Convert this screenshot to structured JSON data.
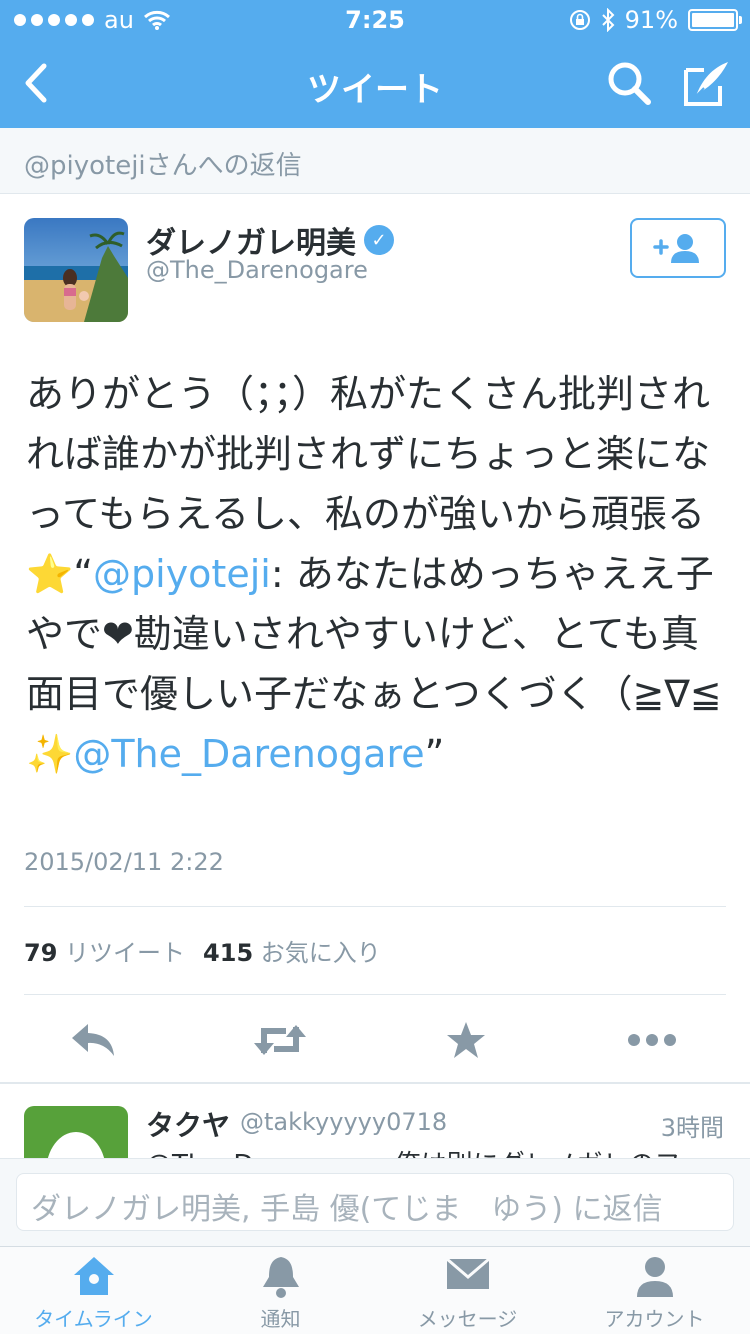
{
  "status_bar": {
    "carrier": "au",
    "time": "7:25",
    "battery": "91%"
  },
  "nav": {
    "title": "ツイート",
    "back_icon": "chevron-left-icon",
    "search_icon": "search-icon",
    "compose_icon": "compose-icon"
  },
  "reply_header": "@piyotejiさんへの返信",
  "tweet": {
    "author_name": "ダレノガレ明美",
    "author_handle": "@The_Darenogare",
    "text_part1": "ありがとう（；；）私がたくさん批判されれば誰かが批判されずにちょっと楽になってもらえるし、私のが強いから頑張る⭐“",
    "mention1": "@piyoteji",
    "text_part2": ": あなたはめっちゃええ子やで❤勘違いされやすいけど、とても真面目で優しい子だなぁとつくづく（≧∇≦✨",
    "mention2": "@The_Darenogare",
    "text_part3": "”",
    "date": "2015/02/11 2:22",
    "retweet_count": "79",
    "retweet_label": "リツイート",
    "favorite_count": "415",
    "favorite_label": "お気に入り"
  },
  "reply_item": {
    "name": "タクヤ",
    "handle": "@takkyyyyy0718",
    "time": "3時間",
    "text": "@The_Darenogare 俺は別にダレノガレのフ"
  },
  "reply_input": {
    "placeholder": "ダレノガレ明美, 手島 優(てじま　ゆう) に返信"
  },
  "tabs": [
    {
      "label": "タイムライン",
      "icon": "home-icon",
      "active": true
    },
    {
      "label": "通知",
      "icon": "bell-icon",
      "active": false
    },
    {
      "label": "メッセージ",
      "icon": "envelope-icon",
      "active": false
    },
    {
      "label": "アカウント",
      "icon": "person-icon",
      "active": false
    }
  ],
  "colors": {
    "brand": "#55acee",
    "text": "#292f33",
    "muted": "#8899a6"
  }
}
